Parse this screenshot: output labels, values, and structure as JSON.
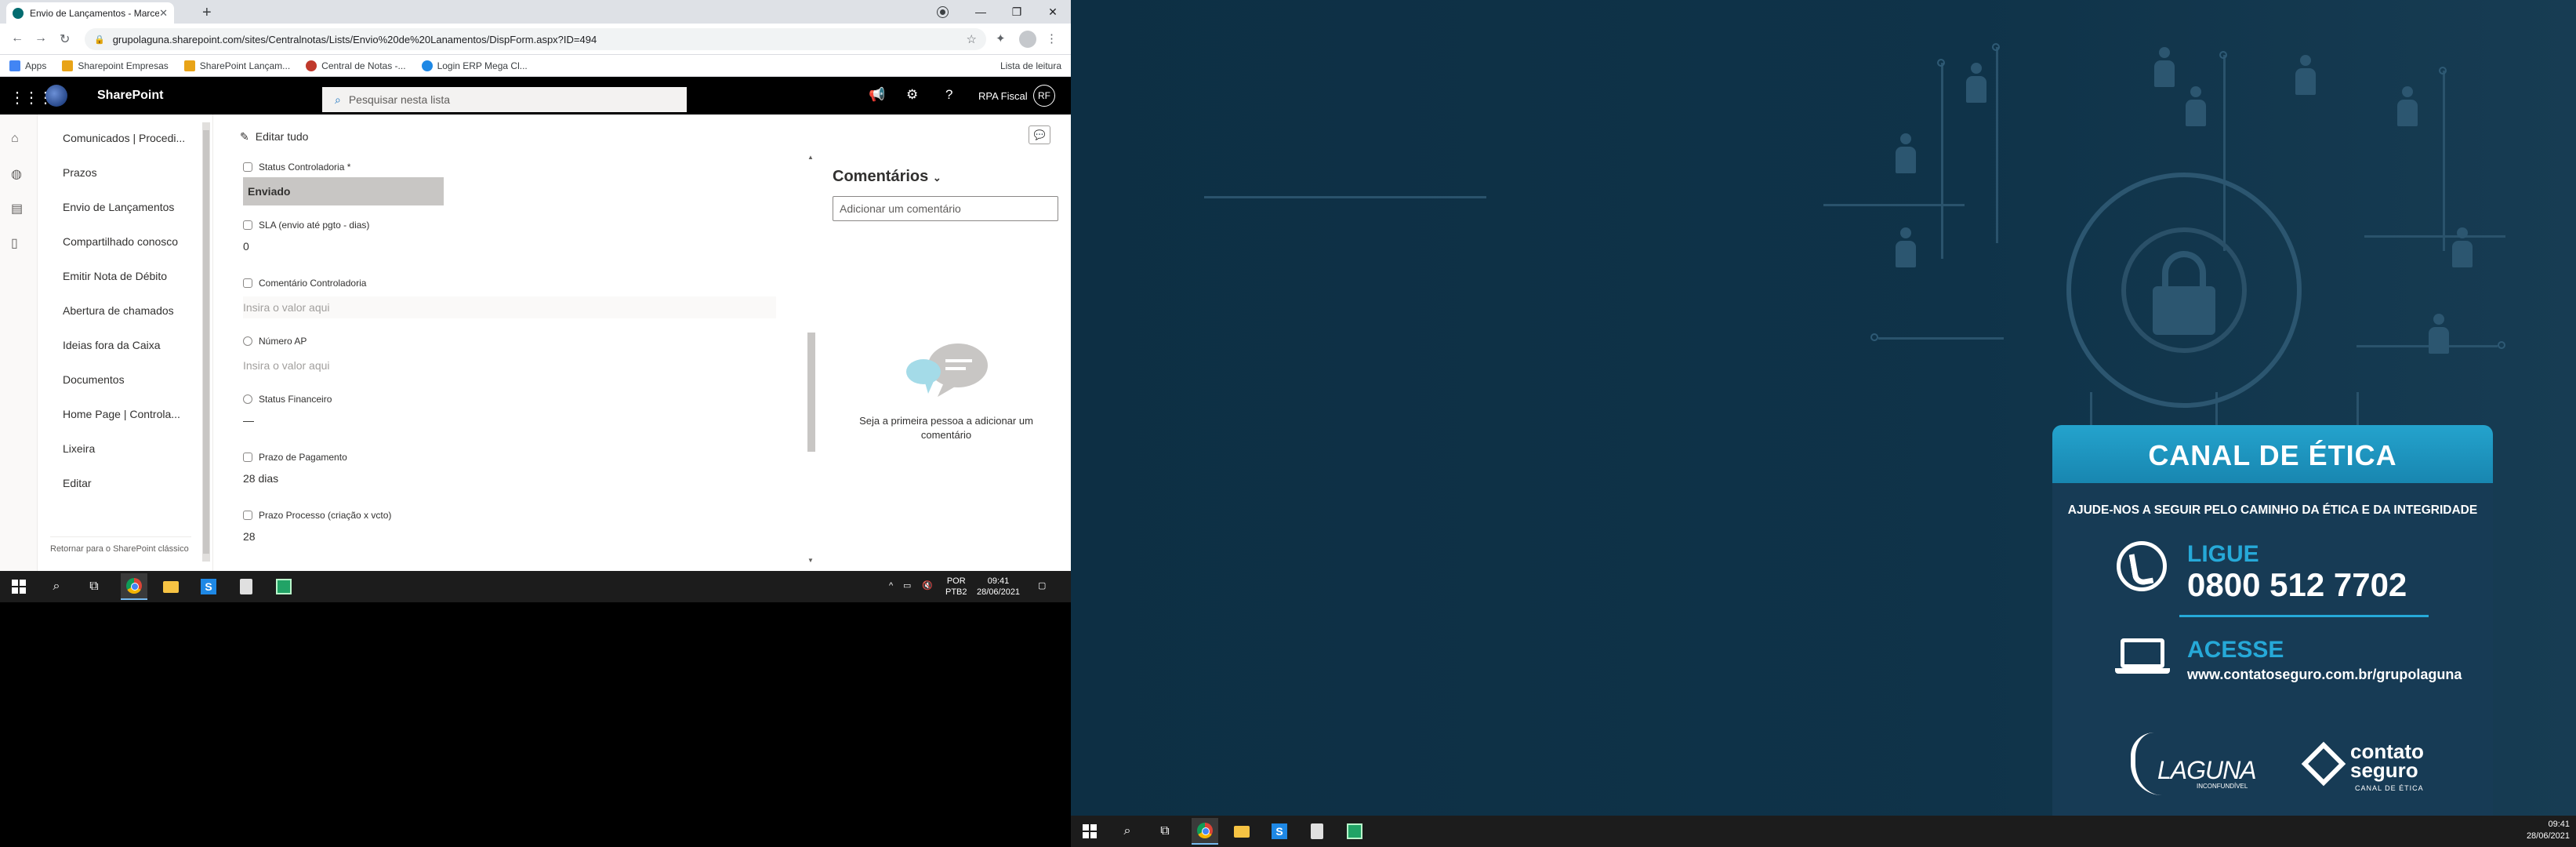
{
  "monitor1": {
    "browser": {
      "tab_title": "Envio de Lançamentos - Marcelo",
      "url": "grupolaguna.sharepoint.com/sites/Centralnotas/Lists/Envio%20de%20Lanamentos/DispForm.aspx?ID=494",
      "bookmarks": [
        {
          "label": "Apps",
          "color": "#4285f4"
        },
        {
          "label": "Sharepoint Empresas",
          "color": "#e8a317"
        },
        {
          "label": "SharePoint Lançam...",
          "color": "#e8a317"
        },
        {
          "label": "Central de Notas -...",
          "color": "#c0392b"
        },
        {
          "label": "Login ERP Mega Cl...",
          "color": "#1e88e5"
        }
      ],
      "reading_list": "Lista de leitura"
    },
    "suite": {
      "app_name": "SharePoint",
      "search_placeholder": "Pesquisar nesta lista",
      "user_name": "RPA Fiscal",
      "user_initials": "RF"
    },
    "nav": {
      "items": [
        "Comunicados | Procedi...",
        "Prazos",
        "Envio de Lançamentos",
        "Compartilhado conosco",
        "Emitir Nota de Débito",
        "Abertura de chamados",
        "Ideias fora da Caixa",
        "Documentos",
        "Home Page | Controla...",
        "Lixeira",
        "Editar"
      ],
      "footer": "Retornar para o SharePoint clássico"
    },
    "command": {
      "edit_all": "Editar tudo"
    },
    "form": {
      "status_controladoria": {
        "label": "Status Controladoria *",
        "value": "Enviado"
      },
      "sla": {
        "label": "SLA (envio até pgto - dias)",
        "value": "0"
      },
      "comentario": {
        "label": "Comentário Controladoria",
        "placeholder": "Insira o valor aqui"
      },
      "numero_ap": {
        "label": "Número AP",
        "placeholder": "Insira o valor aqui"
      },
      "status_financeiro": {
        "label": "Status Financeiro",
        "value": "—"
      },
      "prazo_pagamento": {
        "label": "Prazo de Pagamento",
        "value": "28 dias"
      },
      "prazo_processo": {
        "label": "Prazo Processo (criação x vcto)",
        "value": "28"
      }
    },
    "comments": {
      "title": "Comentários",
      "input_placeholder": "Adicionar um comentário",
      "empty_text": "Seja a primeira pessoa a adicionar um comentário"
    },
    "taskbar": {
      "lang_1": "POR",
      "lang_2": "PTB2",
      "time": "09:41",
      "date": "28/06/2021"
    }
  },
  "monitor2": {
    "wallpaper": {
      "title": "CANAL DE ÉTICA",
      "subtitle": "AJUDE-NOS A SEGUIR PELO CAMINHO DA ÉTICA E DA INTEGRIDADE",
      "call_label": "LIGUE",
      "phone": "0800 512 7702",
      "access_label": "ACESSE",
      "url": "www.contatoseguro.com.br/grupolaguna",
      "brand_1": "LAGUNA",
      "brand_1_tagline": "INCONFUNDÍVEL",
      "brand_2": "contato seguro",
      "brand_2_tagline": "CANAL DE ÉTICA",
      "colors": {
        "accent": "#26a9d8",
        "background": "#0f3349"
      }
    },
    "taskbar": {
      "time": "09:41",
      "date": "28/06/2021"
    }
  }
}
